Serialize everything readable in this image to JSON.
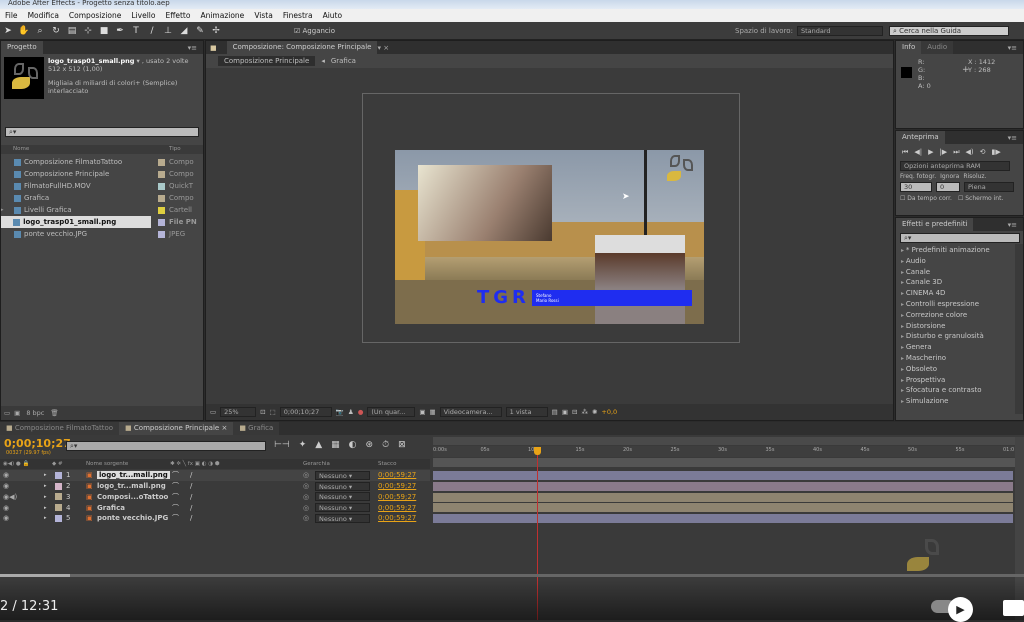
{
  "window": {
    "title": "Adobe After Effects - Progetto senza titolo.aep"
  },
  "menu": [
    "File",
    "Modifica",
    "Composizione",
    "Livello",
    "Effetto",
    "Animazione",
    "Vista",
    "Finestra",
    "Aiuto"
  ],
  "toolbar": {
    "snap_label": "Aggancio",
    "workspace_label": "Spazio di lavoro:",
    "workspace_value": "Standard",
    "help_placeholder": "Cerca nella Guida"
  },
  "project": {
    "tab": "Progetto",
    "selected_name": "logo_trasp01_small.png",
    "used": ", usato 2 volte",
    "dims": "512 x 512 (1,00)",
    "colors": "Migliaia di miliardi di colori+ (Semplice)",
    "interlace": "interlacciato",
    "col_name": "Nome",
    "col_type": "Tipo",
    "bpc": "8 bpc",
    "items": [
      {
        "name": "Composizione FilmatoTattoo",
        "type": "Compo",
        "color": "#b8ab8e"
      },
      {
        "name": "Composizione Principale",
        "type": "Compo",
        "color": "#b8ab8e"
      },
      {
        "name": "FilmatoFullHD.MOV",
        "type": "QuickT",
        "color": "#a9c9c9"
      },
      {
        "name": "Grafica",
        "type": "Compo",
        "color": "#b8ab8e"
      },
      {
        "name": "Livelli Grafica",
        "type": "Cartell",
        "color": "#e0d040"
      },
      {
        "name": "logo_trasp01_small.png",
        "type": "File PN",
        "color": "#b4b4d8"
      },
      {
        "name": "ponte vecchio.JPG",
        "type": "JPEG",
        "color": "#b4b4d8"
      }
    ]
  },
  "composition": {
    "tab": "Composizione: Composizione Principale",
    "crumbs": [
      "Composizione Principale",
      "Grafica"
    ],
    "lower_third": {
      "logo": "TGR",
      "line1": "Stefano",
      "line2": "Mario Rossi"
    },
    "footer": {
      "zoom": "25%",
      "timecode": "0;00;10;27",
      "resolution": "(Un quar...",
      "camera": "Videocamera...",
      "views": "1 vista",
      "exposure": "+0,0"
    }
  },
  "info": {
    "tabs": [
      "Info",
      "Audio"
    ],
    "r": "R:",
    "g": "G:",
    "b": "B:",
    "a": "A:  0",
    "x": "X : 1412",
    "y": "Y : 268"
  },
  "preview": {
    "tab": "Anteprima",
    "ram": "Opzioni anteprima RAM",
    "fps_label": "Freq. fotogr.",
    "skip_label": "Ignora",
    "res_label": "Risoluz.",
    "fps": "30",
    "skip": "0",
    "res": "Piena",
    "from_current": "Da tempo corr.",
    "full_screen": "Schermo int."
  },
  "effects": {
    "tab": "Effetti e predefiniti",
    "items": [
      "* Predefiniti animazione",
      "Audio",
      "Canale",
      "Canale 3D",
      "CINEMA 4D",
      "Controlli espressione",
      "Correzione colore",
      "Distorsione",
      "Disturbo e granulosità",
      "Genera",
      "Mascherino",
      "Obsoleto",
      "Prospettiva",
      "Sfocatura e contrasto",
      "Simulazione"
    ]
  },
  "timeline": {
    "tabs": [
      "Composizione FilmatoTattoo",
      "Composizione Principale",
      "Grafica"
    ],
    "timecode": "0;00;10;27",
    "frames": "00327 (29.97 fps)",
    "col_source": "Nome sorgente",
    "col_parent": "Gerarchia",
    "col_stretch": "Stacco",
    "current_time_s": 10.9,
    "ruler": [
      "0:00s",
      "05s",
      "10s",
      "15s",
      "20s",
      "25s",
      "30s",
      "35s",
      "40s",
      "45s",
      "50s",
      "55s",
      "01:0"
    ],
    "layers": [
      {
        "num": "1",
        "name": "logo_tr...mall.png",
        "parent": "Nessuno",
        "dur": "0;00;59;27",
        "color": "#b4b4d8"
      },
      {
        "num": "2",
        "name": "logo_tr...mall.png",
        "parent": "Nessuno",
        "dur": "0;00;59;27",
        "color": "#d4b4c8"
      },
      {
        "num": "3",
        "name": "Composi...oTattoo",
        "parent": "Nessuno",
        "dur": "0;00;59;27",
        "color": "#b8ab8e"
      },
      {
        "num": "4",
        "name": "Grafica",
        "parent": "Nessuno",
        "dur": "0;00;59;27",
        "color": "#b8ab8e"
      },
      {
        "num": "5",
        "name": "ponte vecchio.JPG",
        "parent": "Nessuno",
        "dur": "0;00;59;27",
        "color": "#b4b4d8"
      }
    ]
  },
  "player": {
    "time": "2 / 12:31"
  },
  "colors": {
    "accent": "#e8a317",
    "lower_third": "#1f2df0"
  }
}
